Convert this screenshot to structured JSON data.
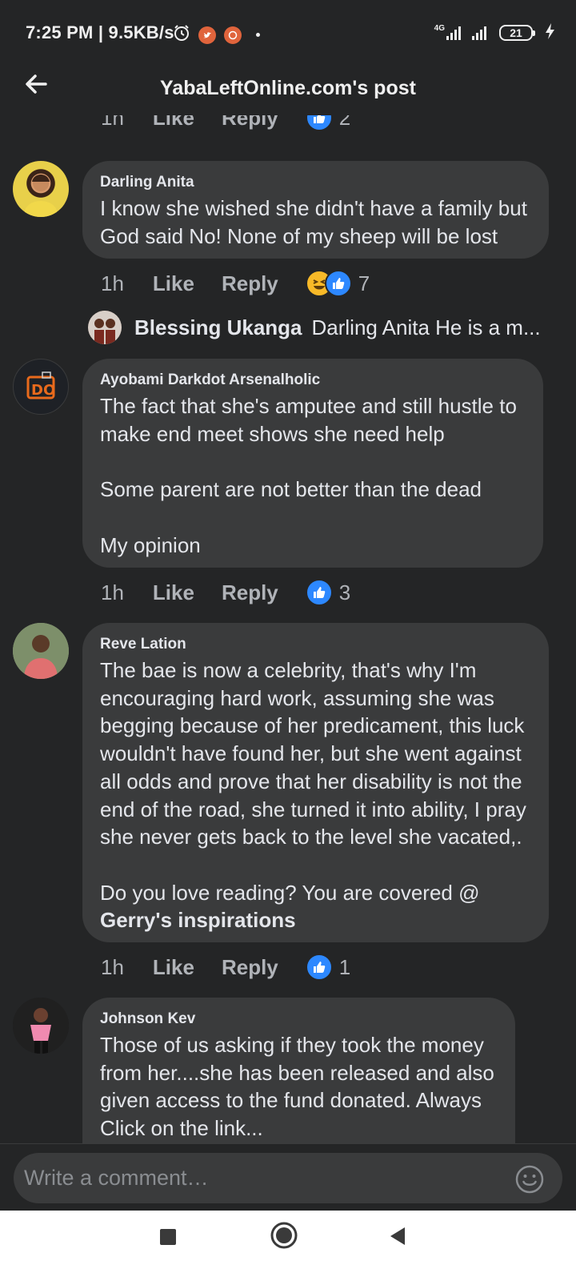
{
  "status_bar": {
    "time": "7:25 PM | 9.5KB/s",
    "network": "4G",
    "battery": "21"
  },
  "header": {
    "title": "YabaLeftOnline.com's post"
  },
  "top_partial": {
    "time": "1h",
    "like": "Like",
    "reply": "Reply",
    "count": "2"
  },
  "comments": [
    {
      "author": "Darling Anita",
      "text": "I know she wished she didn't have a family but God said No! None of my sheep will be lost",
      "time": "1h",
      "like": "Like",
      "reply": "Reply",
      "reactions": [
        "haha",
        "like"
      ],
      "count": "7",
      "reply_preview": {
        "name": "Blessing Ukanga",
        "text": "Darling Anita He is a m..."
      }
    },
    {
      "author": "Ayobami Darkdot Arsenalholic",
      "text": "The fact that she's amputee and still hustle to make end meet shows she need help\n\nSome parent are not better  than the dead\n\nMy opinion",
      "time": "1h",
      "like": "Like",
      "reply": "Reply",
      "reactions": [
        "like"
      ],
      "count": "3"
    },
    {
      "author": "Reve Lation",
      "text": "The bae is now a celebrity, that's why I'm encouraging hard work, assuming she was begging because of her predicament, this luck wouldn't have found her, but she went against all odds and prove that her disability is not the end of the road, she turned it into ability, I pray she never gets back to the level she vacated,.\n\nDo you love reading? You are covered @",
      "link": "Gerry's inspirations",
      "time": "1h",
      "like": "Like",
      "reply": "Reply",
      "reactions": [
        "like"
      ],
      "count": "1"
    },
    {
      "author": "Johnson Kev",
      "text": "Those of us asking if they took the money from her....she has been released and also given access to the fund donated. Always Click on the link..."
    }
  ],
  "composer": {
    "placeholder": "Write a comment…"
  },
  "colors": {
    "background": "#242526",
    "bubble": "#3a3b3c",
    "like_blue": "#2d88ff",
    "haha_yellow": "#f7b928"
  }
}
